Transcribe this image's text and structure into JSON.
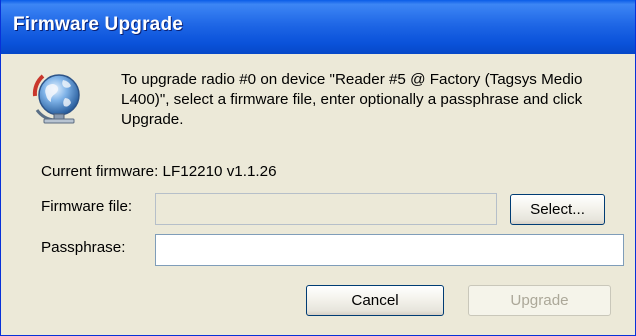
{
  "window": {
    "title": "Firmware Upgrade"
  },
  "icon": {
    "name": "globe-network-icon"
  },
  "message": "To upgrade radio #0 on device \"Reader #5 @ Factory (Tagsys Medio L400)\", select a firmware file, enter optionally a passphrase and click Upgrade.",
  "current_firmware": "Current firmware: LF12210 v1.1.26",
  "firmware_file": {
    "label": "Firmware file:",
    "value": ""
  },
  "select_button": "Select...",
  "passphrase": {
    "label": "Passphrase:",
    "value": ""
  },
  "buttons": {
    "cancel": "Cancel",
    "upgrade": "Upgrade"
  }
}
